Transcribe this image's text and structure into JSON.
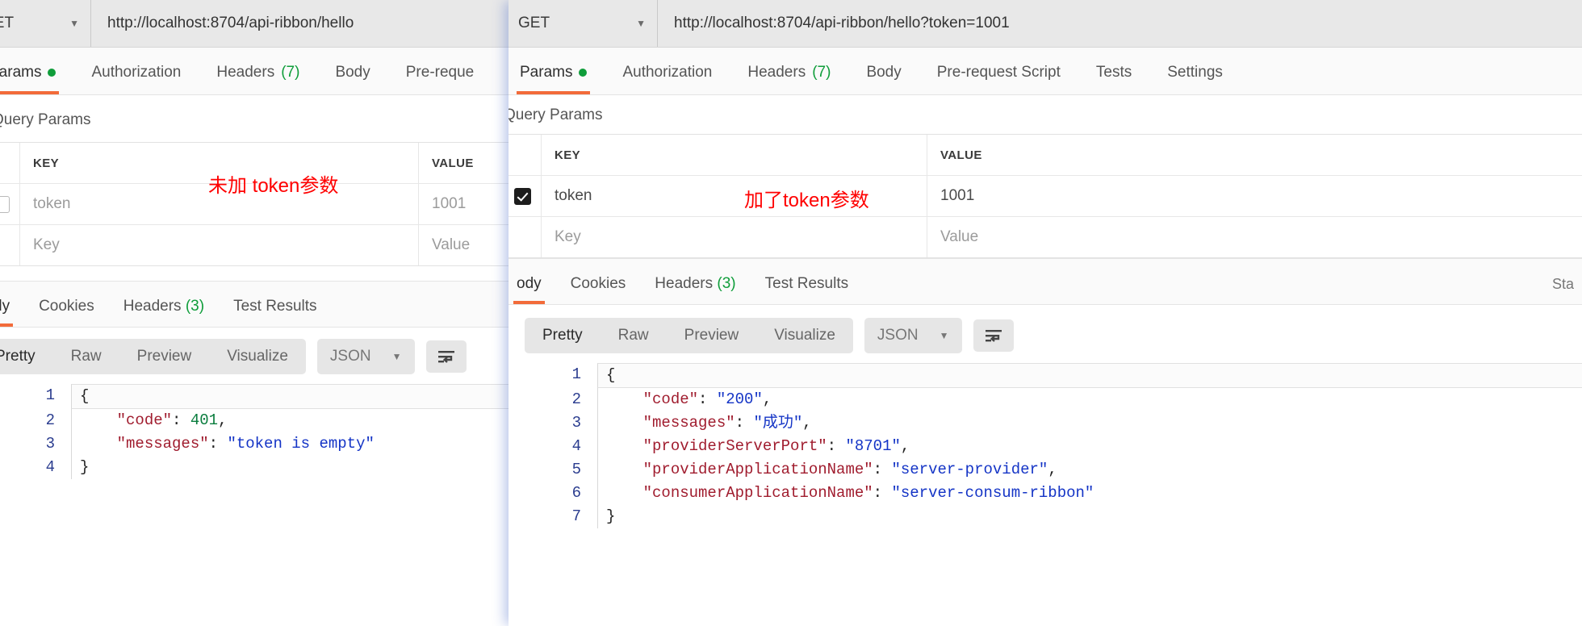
{
  "left": {
    "urlbar": {
      "method": "GET",
      "caret": "▼",
      "url": "http://localhost:8704/api-ribbon/hello"
    },
    "request_tabs": [
      {
        "label": "Params",
        "badge": "",
        "dot": true
      },
      {
        "label": "Authorization",
        "badge": ""
      },
      {
        "label": "Headers",
        "badge": "(7)"
      },
      {
        "label": "Body",
        "badge": ""
      },
      {
        "label": "Pre-reque",
        "badge": ""
      }
    ],
    "query_params": {
      "title": "Query Params",
      "headers": {
        "key": "KEY",
        "value": "VALUE"
      },
      "rows": [
        {
          "checked": false,
          "key": "token",
          "value": "1001",
          "key_muted": true,
          "value_muted": true
        },
        {
          "checked": false,
          "key": "Key",
          "value": "Value",
          "key_muted": true,
          "value_muted": true
        }
      ]
    },
    "annotation": "未加 token参数",
    "response_tabs": [
      {
        "label": "dy",
        "badge": ""
      },
      {
        "label": "Cookies",
        "badge": ""
      },
      {
        "label": "Headers",
        "badge": "(3)"
      },
      {
        "label": "Test Results",
        "badge": ""
      }
    ],
    "format_bar": {
      "segments": [
        "Pretty",
        "Raw",
        "Preview",
        "Visualize"
      ],
      "selected_format": "JSON",
      "caret": "▼"
    },
    "code_lines": [
      {
        "n": "1",
        "tokens": [
          {
            "t": "{",
            "c": "p"
          }
        ]
      },
      {
        "n": "2",
        "tokens": [
          {
            "t": "    ",
            "c": "p"
          },
          {
            "t": "\"code\"",
            "c": "k"
          },
          {
            "t": ": ",
            "c": "p"
          },
          {
            "t": "401",
            "c": "n"
          },
          {
            "t": ",",
            "c": "p"
          }
        ]
      },
      {
        "n": "3",
        "tokens": [
          {
            "t": "    ",
            "c": "p"
          },
          {
            "t": "\"messages\"",
            "c": "k"
          },
          {
            "t": ": ",
            "c": "p"
          },
          {
            "t": "\"token is empty\"",
            "c": "s"
          }
        ]
      },
      {
        "n": "4",
        "tokens": [
          {
            "t": "}",
            "c": "p"
          }
        ]
      }
    ]
  },
  "right": {
    "urlbar": {
      "method": "GET",
      "caret": "▼",
      "url": "http://localhost:8704/api-ribbon/hello?token=1001"
    },
    "request_tabs": [
      {
        "label": "Params",
        "badge": "",
        "dot": true
      },
      {
        "label": "Authorization",
        "badge": ""
      },
      {
        "label": "Headers",
        "badge": "(7)"
      },
      {
        "label": "Body",
        "badge": ""
      },
      {
        "label": "Pre-request Script",
        "badge": ""
      },
      {
        "label": "Tests",
        "badge": ""
      },
      {
        "label": "Settings",
        "badge": ""
      }
    ],
    "query_params": {
      "title": "Query Params",
      "headers": {
        "key": "KEY",
        "value": "VALUE"
      },
      "rows": [
        {
          "checked": true,
          "key": "token",
          "value": "1001",
          "key_muted": false,
          "value_muted": false
        },
        {
          "checked": false,
          "key": "Key",
          "value": "Value",
          "key_muted": true,
          "value_muted": true
        }
      ]
    },
    "annotation": "加了token参数",
    "response_tabs": [
      {
        "label": "ody",
        "badge": ""
      },
      {
        "label": "Cookies",
        "badge": ""
      },
      {
        "label": "Headers",
        "badge": "(3)"
      },
      {
        "label": "Test Results",
        "badge": ""
      }
    ],
    "status_text": "Sta",
    "format_bar": {
      "segments": [
        "Pretty",
        "Raw",
        "Preview",
        "Visualize"
      ],
      "selected_format": "JSON",
      "caret": "▼"
    },
    "code_lines": [
      {
        "n": "1",
        "tokens": [
          {
            "t": "{",
            "c": "p"
          }
        ]
      },
      {
        "n": "2",
        "tokens": [
          {
            "t": "    ",
            "c": "p"
          },
          {
            "t": "\"code\"",
            "c": "k"
          },
          {
            "t": ": ",
            "c": "p"
          },
          {
            "t": "\"200\"",
            "c": "s"
          },
          {
            "t": ",",
            "c": "p"
          }
        ]
      },
      {
        "n": "3",
        "tokens": [
          {
            "t": "    ",
            "c": "p"
          },
          {
            "t": "\"messages\"",
            "c": "k"
          },
          {
            "t": ": ",
            "c": "p"
          },
          {
            "t": "\"成功\"",
            "c": "s"
          },
          {
            "t": ",",
            "c": "p"
          }
        ]
      },
      {
        "n": "4",
        "tokens": [
          {
            "t": "    ",
            "c": "p"
          },
          {
            "t": "\"providerServerPort\"",
            "c": "k"
          },
          {
            "t": ": ",
            "c": "p"
          },
          {
            "t": "\"8701\"",
            "c": "s"
          },
          {
            "t": ",",
            "c": "p"
          }
        ]
      },
      {
        "n": "5",
        "tokens": [
          {
            "t": "    ",
            "c": "p"
          },
          {
            "t": "\"providerApplicationName\"",
            "c": "k"
          },
          {
            "t": ": ",
            "c": "p"
          },
          {
            "t": "\"server-provider\"",
            "c": "s"
          },
          {
            "t": ",",
            "c": "p"
          }
        ]
      },
      {
        "n": "6",
        "tokens": [
          {
            "t": "    ",
            "c": "p"
          },
          {
            "t": "\"consumerApplicationName\"",
            "c": "k"
          },
          {
            "t": ": ",
            "c": "p"
          },
          {
            "t": "\"server-consum-ribbon\"",
            "c": "s"
          }
        ]
      },
      {
        "n": "7",
        "tokens": [
          {
            "t": "}",
            "c": "p"
          }
        ]
      }
    ]
  }
}
